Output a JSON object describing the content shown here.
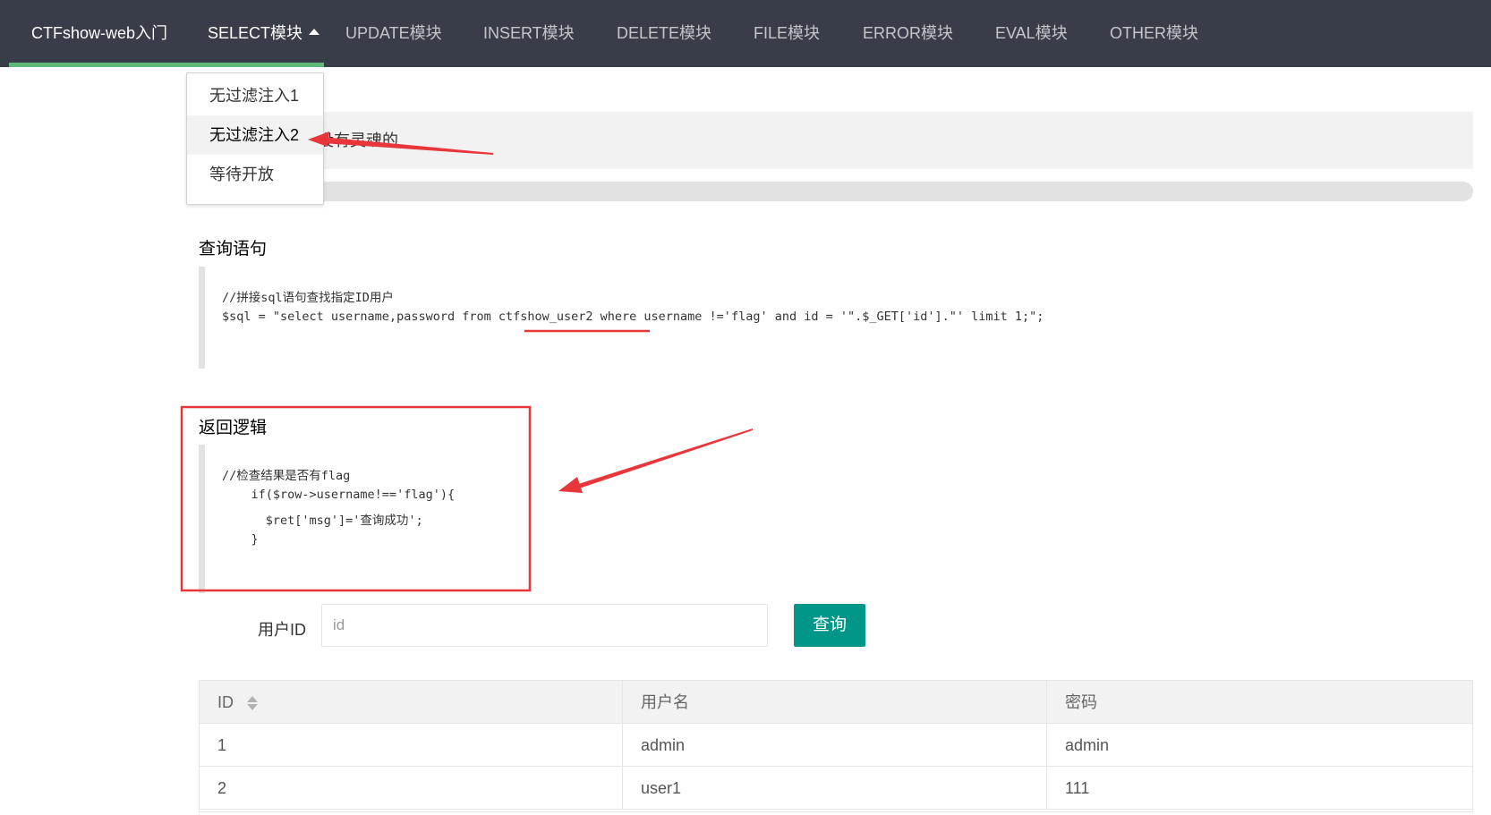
{
  "nav": {
    "brand": "CTFshow-web入门",
    "items": [
      "SELECT模块",
      "UPDATE模块",
      "INSERT模块",
      "DELETE模块",
      "FILE模块",
      "ERROR模块",
      "EVAL模块",
      "OTHER模块"
    ]
  },
  "dropdown": {
    "items": [
      "无过滤注入1",
      "无过滤注入2",
      "等待开放"
    ],
    "active_index": 1
  },
  "header_partial_text": "没有灵魂的",
  "query_section": {
    "title": "查询语句",
    "code": [
      "//拼接sql语句查找指定ID用户",
      "$sql = \"select username,password from ctfshow_user2 where username !='flag' and id = '\".$_GET['id'].\"' limit 1;\";"
    ]
  },
  "return_section": {
    "title": "返回逻辑",
    "code": [
      "//检查结果是否有flag",
      "    if($row->username!=='flag'){",
      "      $ret['msg']='查询成功';",
      "    }"
    ]
  },
  "form": {
    "label": "用户ID",
    "input_placeholder": "id",
    "input_value": "",
    "submit_label": "查询"
  },
  "table": {
    "columns": [
      "ID",
      "用户名",
      "密码"
    ],
    "rows": [
      [
        "1",
        "admin",
        "admin"
      ],
      [
        "2",
        "user1",
        "111"
      ]
    ]
  },
  "colors": {
    "nav_bg": "#393d49",
    "nav_active_underline": "#5fb878",
    "primary_button": "#009688",
    "annotation_red": "#e8363a"
  }
}
